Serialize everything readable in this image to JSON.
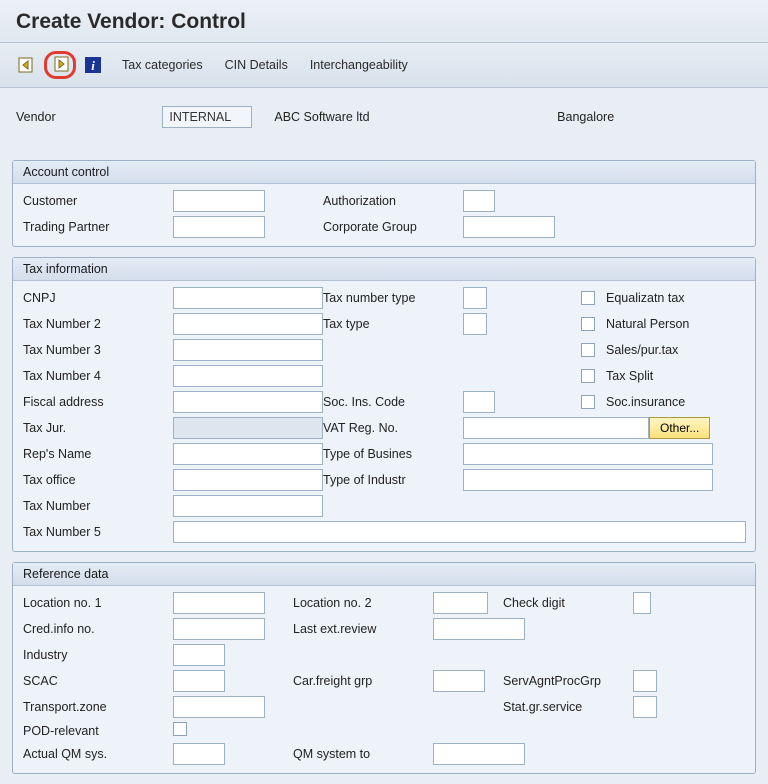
{
  "title": "Create Vendor: Control",
  "toolbar": {
    "tax_categories": "Tax categories",
    "cin_details": "CIN Details",
    "interchangeability": "Interchangeability"
  },
  "header": {
    "vendor_label": "Vendor",
    "vendor_value": "INTERNAL",
    "vendor_name": "ABC Software ltd",
    "vendor_city": "Bangalore"
  },
  "groups": {
    "account_control": {
      "title": "Account control",
      "customer": "Customer",
      "authorization": "Authorization",
      "trading_partner": "Trading Partner",
      "corporate_group": "Corporate Group"
    },
    "tax_info": {
      "title": "Tax information",
      "cnpj": "CNPJ",
      "tax_number_type": "Tax number type",
      "equalizatn_tax": "Equalizatn tax",
      "tax_number_2": "Tax Number 2",
      "tax_type": "Tax type",
      "natural_person": "Natural Person",
      "tax_number_3": "Tax Number 3",
      "sales_pur_tax": "Sales/pur.tax",
      "tax_number_4": "Tax Number 4",
      "tax_split": "Tax Split",
      "fiscal_address": "Fiscal address",
      "soc_ins_code": "Soc. Ins. Code",
      "soc_insurance": "Soc.insurance",
      "tax_jur": "Tax Jur.",
      "vat_reg_no": "VAT Reg. No.",
      "other_btn": "Other...",
      "reps_name": "Rep's Name",
      "type_of_business": "Type of Busines",
      "tax_office": "Tax office",
      "type_of_industry": "Type of Industr",
      "tax_number": "Tax Number",
      "tax_number_5": "Tax Number 5"
    },
    "reference": {
      "title": "Reference data",
      "location_no_1": "Location no. 1",
      "location_no_2": "Location no. 2",
      "check_digit": "Check digit",
      "cred_info_no": "Cred.info no.",
      "last_ext_review": "Last ext.review",
      "industry": "Industry",
      "scac": "SCAC",
      "car_freight_grp": "Car.freight grp",
      "serv_agnt_proc_grp": "ServAgntProcGrp",
      "transport_zone": "Transport.zone",
      "stat_gr_service": "Stat.gr.service",
      "pod_relevant": "POD-relevant",
      "actual_qm_sys": "Actual QM sys.",
      "qm_system_to": "QM system to"
    }
  }
}
